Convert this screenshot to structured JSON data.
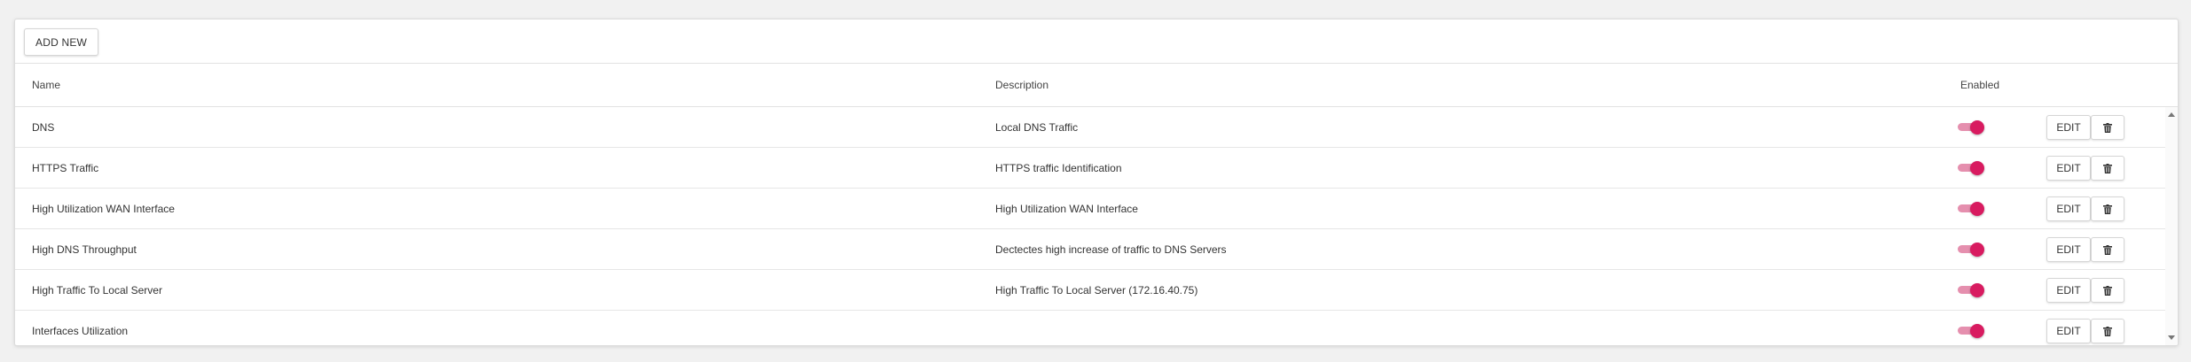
{
  "toolbar": {
    "add_label": "ADD NEW"
  },
  "table": {
    "columns": {
      "name": "Name",
      "description": "Description",
      "enabled": "Enabled"
    },
    "rows": [
      {
        "name": "DNS",
        "description": "Local DNS Traffic",
        "enabled": true,
        "edit_label": "EDIT"
      },
      {
        "name": "HTTPS Traffic",
        "description": "HTTPS traffic Identification",
        "enabled": true,
        "edit_label": "EDIT"
      },
      {
        "name": "High Utilization WAN Interface",
        "description": "High Utilization WAN Interface",
        "enabled": true,
        "edit_label": "EDIT"
      },
      {
        "name": "High DNS Throughput",
        "description": "Dectectes high increase of traffic to DNS Servers",
        "enabled": true,
        "edit_label": "EDIT"
      },
      {
        "name": "High Traffic To Local Server",
        "description": "High Traffic To Local Server (172.16.40.75)",
        "enabled": true,
        "edit_label": "EDIT"
      },
      {
        "name": "Interfaces Utilization",
        "description": "",
        "enabled": true,
        "edit_label": "EDIT"
      }
    ]
  },
  "icons": {
    "delete": "trash-icon",
    "toggle": "toggle-switch"
  },
  "colors": {
    "accent": "#d81b60",
    "accent_track": "#e58fae"
  }
}
